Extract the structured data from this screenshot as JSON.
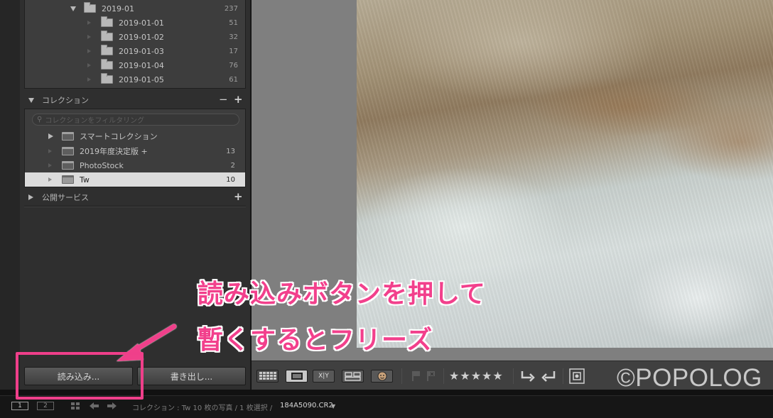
{
  "folders": {
    "parent": {
      "label": "2019-01",
      "count": "237"
    },
    "items": [
      {
        "label": "2019-01-01",
        "count": "51"
      },
      {
        "label": "2019-01-02",
        "count": "32"
      },
      {
        "label": "2019-01-03",
        "count": "17"
      },
      {
        "label": "2019-01-04",
        "count": "76"
      },
      {
        "label": "2019-01-05",
        "count": "61"
      }
    ]
  },
  "collections": {
    "header": "コレクション",
    "remove_label": "−",
    "add_label": "+",
    "filter_placeholder": "コレクションをフィルタリング",
    "items": [
      {
        "label": "スマートコレクション",
        "count": ""
      },
      {
        "label": "2019年度決定版 +",
        "count": "13"
      },
      {
        "label": "PhotoStock",
        "count": "2"
      },
      {
        "label": "Tw",
        "count": "10"
      }
    ]
  },
  "publish": {
    "header": "公開サービス",
    "add_label": "+"
  },
  "buttons": {
    "import_label": "読み込み...",
    "export_label": "書き出し..."
  },
  "toolbar": {
    "compare_label": "X|Y",
    "rating_stars": "★★★★★"
  },
  "filmstrip": {
    "page1": "1",
    "page2": "2",
    "source_text": "コレクション : Tw  10 枚の写真 / 1 枚選択 /",
    "filename": "184A5090.CR2"
  },
  "annotation": {
    "line1": "読み込みボタンを押して",
    "line2": "暫くするとフリーズ",
    "accent_color": "#f2408c"
  },
  "watermark": "©POPOLOG"
}
